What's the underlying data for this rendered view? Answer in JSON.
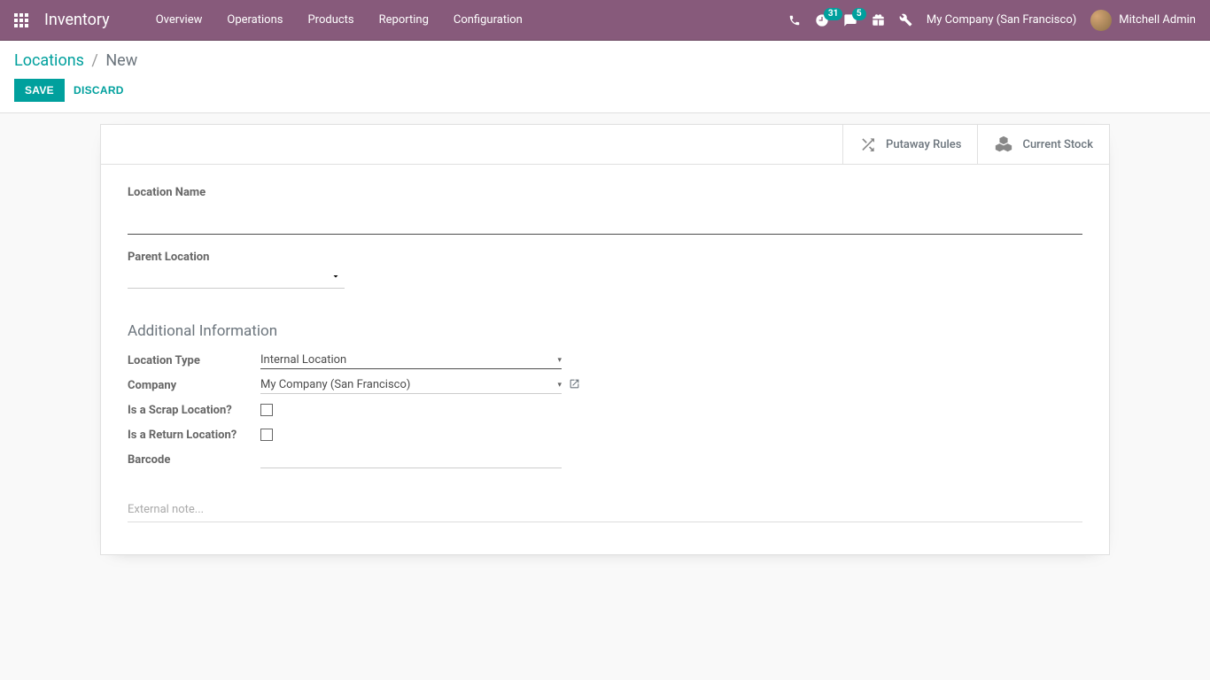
{
  "navbar": {
    "brand": "Inventory",
    "menu": [
      "Overview",
      "Operations",
      "Products",
      "Reporting",
      "Configuration"
    ],
    "activities_count": "31",
    "messages_count": "5",
    "company": "My Company (San Francisco)",
    "user": "Mitchell Admin"
  },
  "breadcrumb": {
    "parent": "Locations",
    "sep": "/",
    "active": "New"
  },
  "buttons": {
    "save": "SAVE",
    "discard": "DISCARD"
  },
  "stat_buttons": {
    "putaway": "Putaway Rules",
    "current_stock": "Current Stock"
  },
  "form": {
    "location_name_label": "Location Name",
    "location_name_value": "",
    "parent_location_label": "Parent Location",
    "parent_location_value": "",
    "section_title": "Additional Information",
    "location_type_label": "Location Type",
    "location_type_value": "Internal Location",
    "company_label": "Company",
    "company_value": "My Company (San Francisco)",
    "scrap_label": "Is a Scrap Location?",
    "return_label": "Is a Return Location?",
    "barcode_label": "Barcode",
    "barcode_value": "",
    "note_placeholder": "External note..."
  }
}
